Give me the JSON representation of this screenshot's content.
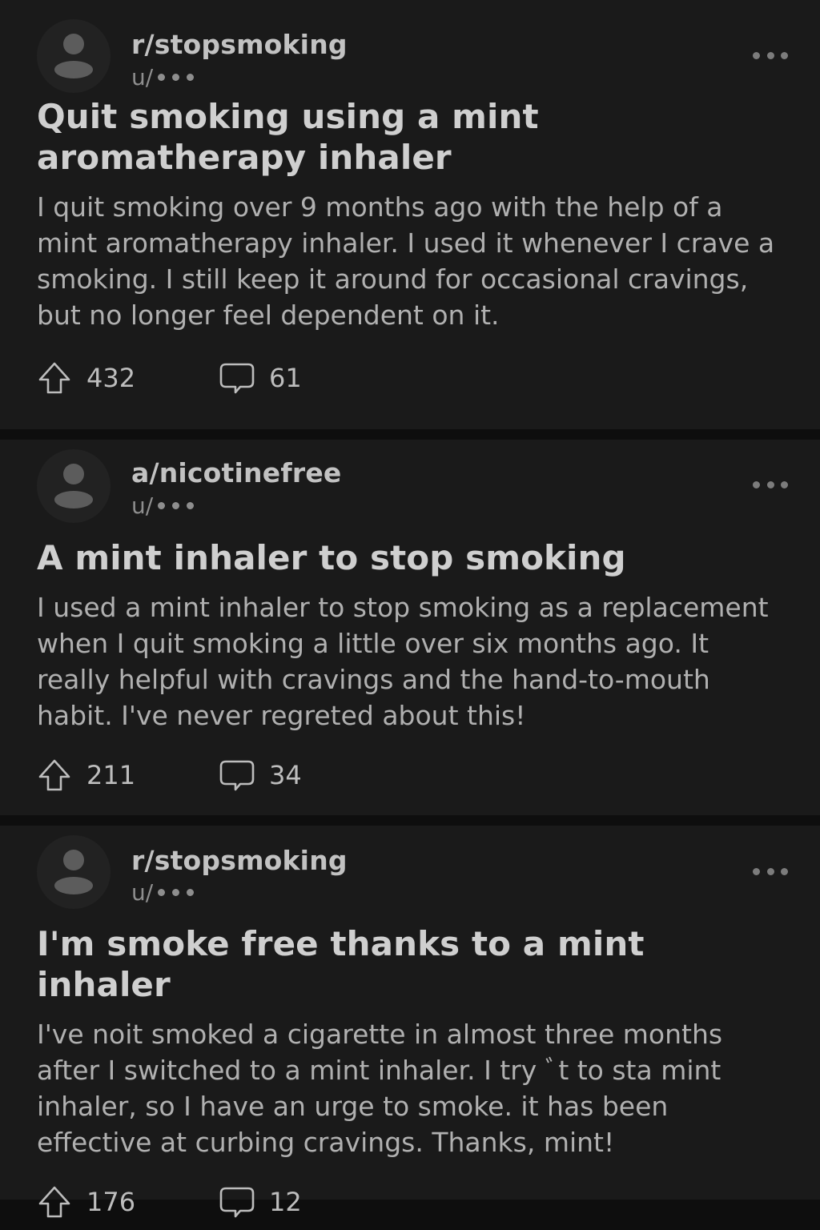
{
  "posts": [
    {
      "community": "r/stopsmoking",
      "user": "u/",
      "title": "Quit smoking using a mint aromatherapy inhaler",
      "body": "I quit smoking over 9 months ago with the help of a mint aromatherapy inhaler. I used it whenever I crave a smoking. I still keep it around for occasional cravings, but no longer feel dependent on it.",
      "upvotes": "432",
      "comments": "61"
    },
    {
      "community": "a/nicotinefree",
      "user": "u/",
      "title": "A mint inhaler to stop smoking",
      "body": "I used a mint inhaler to stop smoking as a replacement when I quit smoking a little over six months ago. It really helpful with cravings and the hand-to-mouth habit. I've never regreted about this!",
      "upvotes": "211",
      "comments": "34"
    },
    {
      "community": "r/stopsmoking",
      "user": "u/",
      "title": "I'm smoke free thanks to a mint inhaler",
      "body": "I've noit smoked a cigarette in almost three months after I switched to a mint inhaler. I try ﾞt to sta mint inhaler, so I have an urge to smoke. it has been effective at curbing cravings. Thanks, mint!",
      "upvotes": "176",
      "comments": "12"
    }
  ],
  "icons": {
    "avatar": "user-avatar-icon",
    "more": "more-options-icon",
    "upvote": "upvote-arrow-icon",
    "comment": "comment-bubble-icon"
  },
  "colors": {
    "background": "#0e0e0e",
    "card": "#1a1a1a",
    "text_primary": "#cfcfcf",
    "text_secondary": "#8e8e8e"
  }
}
